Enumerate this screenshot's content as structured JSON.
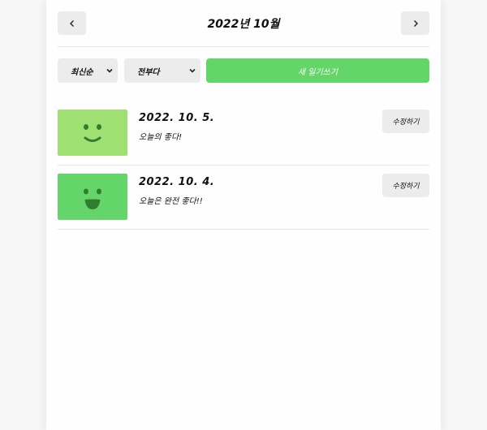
{
  "header": {
    "title": "2022년 10월",
    "prev_icon": "chevron-left-icon",
    "next_icon": "chevron-right-icon"
  },
  "controls": {
    "sort_value": "최신순",
    "filter_value": "전부다",
    "new_button_label": "새 일기쓰기",
    "accent_color": "#64d568"
  },
  "entries": [
    {
      "date": "2022. 10. 5.",
      "content": "오늘의 좋다!",
      "edit_label": "수정하기",
      "emotion_icon": "smile-icon",
      "color": "#9fe073"
    },
    {
      "date": "2022. 10. 4.",
      "content": "오늘은 완전 좋다!!",
      "edit_label": "수정하기",
      "emotion_icon": "big-smile-icon",
      "color": "#64d568"
    }
  ]
}
